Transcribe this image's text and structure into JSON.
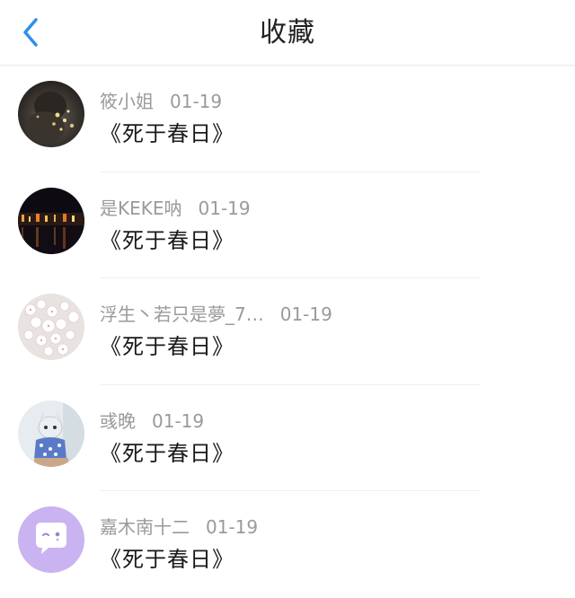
{
  "header": {
    "title": "收藏",
    "back_icon": "chevron-left-icon",
    "accent_color": "#2e8ff0"
  },
  "items": [
    {
      "user": "筱小姐",
      "date": "01-19",
      "title": "《死于春日》",
      "avatar": "dark-bokeh-photo"
    },
    {
      "user": "是KEKE呐",
      "date": "01-19",
      "title": "《死于春日》",
      "avatar": "night-city-photo"
    },
    {
      "user": "浮生丶若只是夢_7…",
      "date": "01-19",
      "title": "《死于春日》",
      "avatar": "cherry-blossom-photo"
    },
    {
      "user": "彧晚",
      "date": "01-19",
      "title": "《死于春日》",
      "avatar": "cat-photo"
    },
    {
      "user": "嘉木南十二",
      "date": "01-19",
      "title": "《死于春日》",
      "avatar": "default-chat-bubble-avatar"
    }
  ]
}
